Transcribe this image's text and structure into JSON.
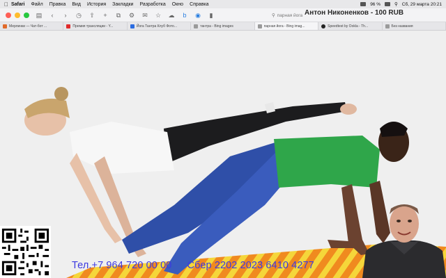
{
  "menubar": {
    "app": "Safari",
    "items": [
      "Файл",
      "Правка",
      "Вид",
      "История",
      "Закладки",
      "Разработка",
      "Окно",
      "Справка"
    ],
    "battery": "96 %",
    "datetime": "Сб, 29 марта 20:21"
  },
  "toolbar": {
    "address": "парная йога"
  },
  "stream_title": "Антон Никоненков - 100 RUB",
  "tabs": [
    {
      "label": "Мерлинки — Чат-бот ...",
      "color": "#e06a2b"
    },
    {
      "label": "Премия трансляции - Y...",
      "color": "#e02b2b"
    },
    {
      "label": "Йога Тантра Клуб Фото...",
      "color": "#2b6ce0"
    },
    {
      "label": "тантра - Bing images",
      "color": "#888888"
    },
    {
      "label": "парная йога - Bing imag...",
      "color": "#888888"
    },
    {
      "label": "Speedtest by Ookla - Th...",
      "color": "#222222"
    },
    {
      "label": "Без названия",
      "color": "#888888"
    }
  ],
  "donation": {
    "phone": "Тел.+7 964 720 00 00",
    "bank": "Сбер 2202 2023 6410 4277"
  },
  "colors": {
    "donation_text": "#3d3ae0",
    "mat_orange": "#f08a1f",
    "mat_yellow": "#f5d63a",
    "shirt_green": "#2fa64a",
    "jeans_blue": "#2f4fa8"
  }
}
